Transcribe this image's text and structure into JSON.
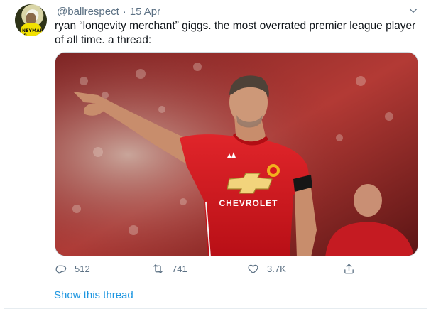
{
  "tweet": {
    "author_handle": "@ballrespect",
    "separator": "·",
    "date": "15 Apr",
    "text": "ryan “longevity merchant” giggs. the most overrated premier league player of all time. a thread:",
    "avatar_name_text": "NEYMAR JR",
    "media": {
      "sponsor_text": "CHEVROLET",
      "description_icon": "photo"
    },
    "actions": {
      "reply_count": "512",
      "retweet_count": "741",
      "like_count": "3.7K"
    },
    "show_thread_label": "Show this thread"
  },
  "colors": {
    "text_primary": "#0f1419",
    "text_secondary": "#5b7083",
    "link": "#1b95e0",
    "jersey_red": "#d7171f",
    "border": "#e6ecf0"
  },
  "icons": {
    "reply": "reply-icon",
    "retweet": "retweet-icon",
    "like": "heart-icon",
    "share": "share-icon",
    "menu": "chevron-down-icon"
  }
}
